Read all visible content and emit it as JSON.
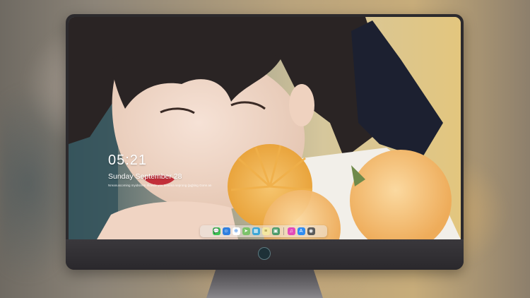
{
  "lockscreen": {
    "time": "05:21",
    "date": "Sunday September 28",
    "tagline": "Nreanuscoming myidsirem Ihowde you tenema seprong (pg)ting Gonn an"
  },
  "dock": {
    "apps": [
      {
        "name": "messages",
        "icon": "messages-icon",
        "color": "#3ec254",
        "glyph": "💬"
      },
      {
        "name": "finder",
        "icon": "finder-icon",
        "color": "#2f7fe0",
        "glyph": "☺"
      },
      {
        "name": "safari",
        "icon": "safari-icon",
        "color": "#ffffff",
        "glyph": "⊕"
      },
      {
        "name": "maps",
        "icon": "maps-icon",
        "color": "#7cc36a",
        "glyph": "➤"
      },
      {
        "name": "claquette",
        "icon": "claquette-icon",
        "color": "#3aa6d6",
        "glyph": "▦"
      },
      {
        "name": "notes",
        "icon": "notes-icon",
        "color": "#f4e7a1",
        "glyph": "≡"
      },
      {
        "name": "photos",
        "icon": "photos-icon",
        "color": "#4c9b6a",
        "glyph": "▣"
      },
      {
        "name": "itunes",
        "icon": "music-icon",
        "color": "#e24bb8",
        "glyph": "♫"
      },
      {
        "name": "app-store",
        "icon": "app-store-icon",
        "color": "#2f8cf0",
        "glyph": "A"
      },
      {
        "name": "camera",
        "icon": "camera-icon",
        "color": "#5a5a5a",
        "glyph": "◉"
      }
    ]
  }
}
